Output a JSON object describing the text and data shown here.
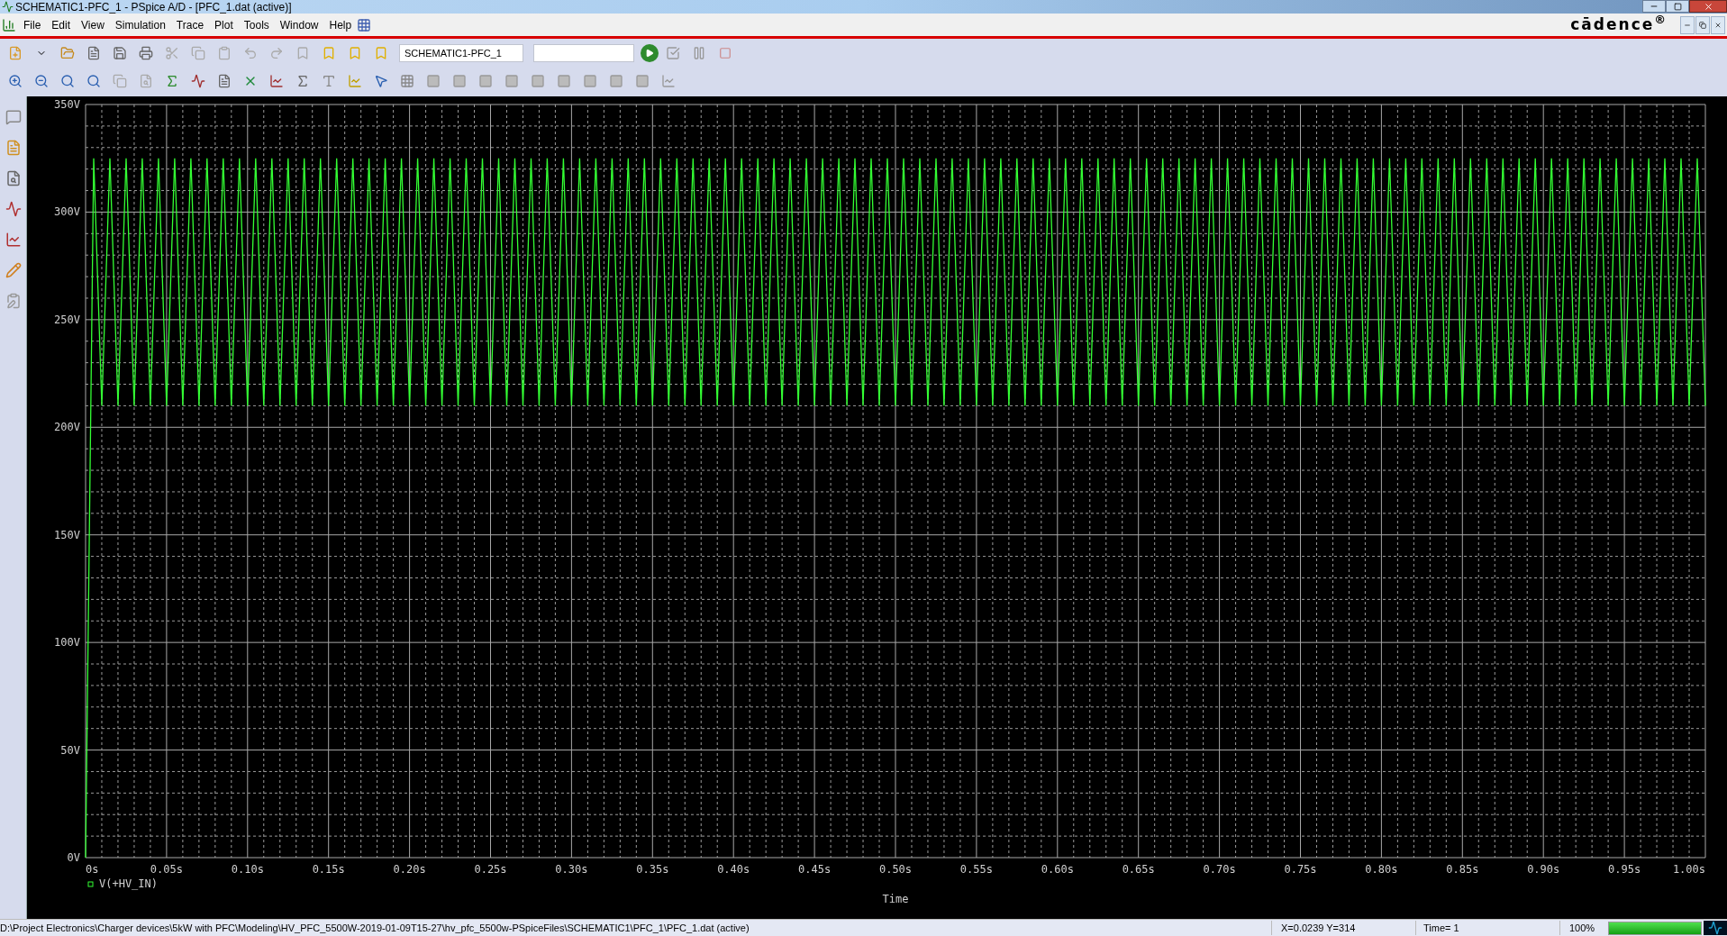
{
  "window": {
    "title": "SCHEMATIC1-PFC_1 - PSpice A/D  - [PFC_1.dat (active)]"
  },
  "menu": [
    "File",
    "Edit",
    "View",
    "Simulation",
    "Trace",
    "Plot",
    "Tools",
    "Window",
    "Help"
  ],
  "logo": "cādence$^{®}$",
  "toolbar": {
    "simulation_profile": "SCHEMATIC1-PFC_1"
  },
  "plot": {
    "chart_data": {
      "type": "line",
      "grid": true,
      "xlabel": "Time",
      "xlim": [
        0,
        1
      ],
      "ylim": [
        0,
        350
      ],
      "xticks": [
        {
          "value": 0,
          "label": "0s"
        },
        {
          "value": 0.05,
          "label": "0.05s"
        },
        {
          "value": 0.1,
          "label": "0.10s"
        },
        {
          "value": 0.15,
          "label": "0.15s"
        },
        {
          "value": 0.2,
          "label": "0.20s"
        },
        {
          "value": 0.25,
          "label": "0.25s"
        },
        {
          "value": 0.3,
          "label": "0.30s"
        },
        {
          "value": 0.35,
          "label": "0.35s"
        },
        {
          "value": 0.4,
          "label": "0.40s"
        },
        {
          "value": 0.45,
          "label": "0.45s"
        },
        {
          "value": 0.5,
          "label": "0.50s"
        },
        {
          "value": 0.55,
          "label": "0.55s"
        },
        {
          "value": 0.6,
          "label": "0.60s"
        },
        {
          "value": 0.65,
          "label": "0.65s"
        },
        {
          "value": 0.7,
          "label": "0.70s"
        },
        {
          "value": 0.75,
          "label": "0.75s"
        },
        {
          "value": 0.8,
          "label": "0.80s"
        },
        {
          "value": 0.85,
          "label": "0.85s"
        },
        {
          "value": 0.9,
          "label": "0.90s"
        },
        {
          "value": 0.95,
          "label": "0.95s"
        },
        {
          "value": 1,
          "label": "1.00s"
        }
      ],
      "yticks": [
        {
          "value": 0,
          "label": "0V"
        },
        {
          "value": 50,
          "label": "50V"
        },
        {
          "value": 100,
          "label": "100V"
        },
        {
          "value": 150,
          "label": "150V"
        },
        {
          "value": 200,
          "label": "200V"
        },
        {
          "value": 250,
          "label": "250V"
        },
        {
          "value": 300,
          "label": "300V"
        },
        {
          "value": 350,
          "label": "350V"
        }
      ],
      "x": [
        0,
        0.005,
        0.01,
        0.015,
        0.02,
        0.025,
        0.03,
        0.035,
        0.04,
        0.045,
        0.05,
        0.055,
        0.06,
        0.065,
        0.07,
        0.075,
        0.08,
        0.085,
        0.09,
        0.095,
        0.1,
        0.105,
        0.11,
        0.115,
        0.12,
        0.125,
        0.13,
        0.135,
        0.14,
        0.145,
        0.15,
        0.155,
        0.16,
        0.165,
        0.17,
        0.175,
        0.18,
        0.185,
        0.19,
        0.195,
        0.2,
        0.205,
        0.21,
        0.215,
        0.22,
        0.225,
        0.23,
        0.235,
        0.24,
        0.245,
        0.25,
        0.255,
        0.26,
        0.265,
        0.27,
        0.275,
        0.28,
        0.285,
        0.29,
        0.295,
        0.3,
        0.305,
        0.31,
        0.315,
        0.32,
        0.325,
        0.33,
        0.335,
        0.34,
        0.345,
        0.35,
        0.355,
        0.36,
        0.365,
        0.37,
        0.375,
        0.38,
        0.385,
        0.39,
        0.395,
        0.4,
        0.405,
        0.41,
        0.415,
        0.42,
        0.425,
        0.43,
        0.435,
        0.44,
        0.445,
        0.45,
        0.455,
        0.46,
        0.465,
        0.47,
        0.475,
        0.48,
        0.485,
        0.49,
        0.495,
        0.5,
        0.505,
        0.51,
        0.515,
        0.52,
        0.525,
        0.53,
        0.535,
        0.54,
        0.545,
        0.55,
        0.555,
        0.56,
        0.565,
        0.57,
        0.575,
        0.58,
        0.585,
        0.59,
        0.595,
        0.6,
        0.605,
        0.61,
        0.615,
        0.62,
        0.625,
        0.63,
        0.635,
        0.64,
        0.645,
        0.65,
        0.655,
        0.66,
        0.665,
        0.67,
        0.675,
        0.68,
        0.685,
        0.69,
        0.695,
        0.7,
        0.705,
        0.71,
        0.715,
        0.72,
        0.725,
        0.73,
        0.735,
        0.74,
        0.745,
        0.75,
        0.755,
        0.76,
        0.765,
        0.77,
        0.775,
        0.78,
        0.785,
        0.79,
        0.795,
        0.8,
        0.805,
        0.81,
        0.815,
        0.82,
        0.825,
        0.83,
        0.835,
        0.84,
        0.845,
        0.85,
        0.855,
        0.86,
        0.865,
        0.87,
        0.875,
        0.88,
        0.885,
        0.89,
        0.895,
        0.9,
        0.905,
        0.91,
        0.915,
        0.92,
        0.925,
        0.93,
        0.935,
        0.94,
        0.945,
        0.95,
        0.955,
        0.96,
        0.965,
        0.97,
        0.975,
        0.98,
        0.985,
        0.99,
        0.995,
        1
      ],
      "series": [
        {
          "name": "V(+HV_IN)",
          "color": "#33ff33",
          "values": [
            0,
            325,
            210,
            325,
            210,
            325,
            210,
            325,
            210,
            325,
            210,
            325,
            210,
            325,
            210,
            325,
            210,
            325,
            210,
            325,
            210,
            325,
            210,
            325,
            210,
            325,
            210,
            325,
            210,
            325,
            210,
            325,
            210,
            325,
            210,
            325,
            210,
            325,
            210,
            325,
            210,
            325,
            210,
            325,
            210,
            325,
            210,
            325,
            210,
            325,
            210,
            325,
            210,
            325,
            210,
            325,
            210,
            325,
            210,
            325,
            210,
            325,
            210,
            325,
            210,
            325,
            210,
            325,
            210,
            325,
            210,
            325,
            210,
            325,
            210,
            325,
            210,
            325,
            210,
            325,
            210,
            325,
            210,
            325,
            210,
            325,
            210,
            325,
            210,
            325,
            210,
            325,
            210,
            325,
            210,
            325,
            210,
            325,
            210,
            325,
            210,
            325,
            210,
            325,
            210,
            325,
            210,
            325,
            210,
            325,
            210,
            325,
            210,
            325,
            210,
            325,
            210,
            325,
            210,
            325,
            210,
            325,
            210,
            325,
            210,
            325,
            210,
            325,
            210,
            325,
            210,
            325,
            210,
            325,
            210,
            325,
            210,
            325,
            210,
            325,
            210,
            325,
            210,
            325,
            210,
            325,
            210,
            325,
            210,
            325,
            210,
            325,
            210,
            325,
            210,
            325,
            210,
            325,
            210,
            325,
            210,
            325,
            210,
            325,
            210,
            325,
            210,
            325,
            210,
            325,
            210,
            325,
            210,
            325,
            210,
            325,
            210,
            325,
            210,
            325,
            210,
            325,
            210,
            325,
            210,
            325,
            210,
            325,
            210,
            325,
            210,
            325,
            210,
            325,
            210,
            325,
            210,
            325,
            210,
            325,
            210
          ]
        }
      ]
    }
  },
  "status_bar": {
    "path": "D:\\Project Electronics\\Charger devices\\5kW with PFC\\Modeling\\HV_PFC_5500W-2019-01-09T15-27\\hv_pfc_5500w-PSpiceFiles\\SCHEMATIC1\\PFC_1\\PFC_1.dat (active)",
    "cursor": "X=0.0239  Y=314",
    "time": "Time= 1",
    "zoom": "100%",
    "progress": {
      "level": 1
    }
  }
}
